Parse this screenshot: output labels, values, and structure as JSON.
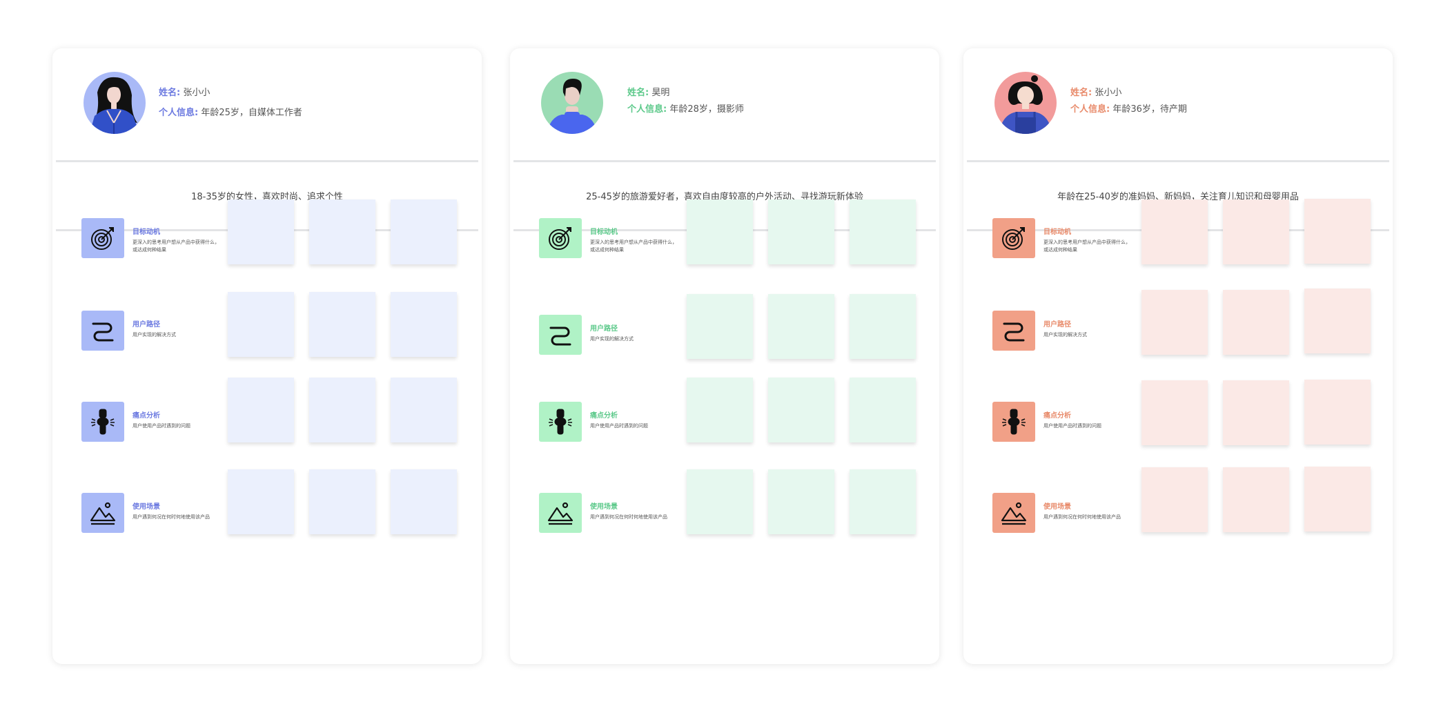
{
  "theme_colors": {
    "blue": {
      "accent": "#6b79e0",
      "avatar_bg": "#a9b9f7",
      "icon_bg": "#a9b9f7",
      "note": "#ebf0fd"
    },
    "green": {
      "accent": "#5cc98a",
      "avatar_bg": "#9adcb4",
      "icon_bg": "#b0f2c6",
      "note": "#e6f8ef"
    },
    "red": {
      "accent": "#e88a6a",
      "avatar_bg": "#f29b9b",
      "icon_bg": "#f1a087",
      "note": "#fbe9e6"
    }
  },
  "personas": [
    {
      "theme": "blue",
      "name_label": "姓名:",
      "name": "张小小",
      "info_label": "个人信息:",
      "info": "年龄25岁，自媒体工作者",
      "description": "18-35岁的女性，喜欢时尚、追求个性",
      "avatar_icon": "woman-long-hair-avatar-icon",
      "sections": [
        {
          "icon": "target-icon",
          "title": "目标动机",
          "desc": "更深入的思考用户想从产品中获得什么，或达成何种结果"
        },
        {
          "icon": "path-icon",
          "title": "用户路径",
          "desc": "用户实现的解决方式"
        },
        {
          "icon": "joint-pain-icon",
          "title": "痛点分析",
          "desc": "用户使用产品时遇到的问题"
        },
        {
          "icon": "landscape-icon",
          "title": "使用场景",
          "desc": "用户遇到何况在何时何地使用该产品"
        }
      ]
    },
    {
      "theme": "green",
      "name_label": "姓名:",
      "name": "昊明",
      "info_label": "个人信息:",
      "info": "年龄28岁，摄影师",
      "description": "25-45岁的旅游爱好者，喜欢自由度较高的户外活动、寻找游玩新体验",
      "avatar_icon": "man-turtleneck-avatar-icon",
      "sections": [
        {
          "icon": "target-icon",
          "title": "目标动机",
          "desc": "更深入的思考用户想从产品中获得什么，或达成何种结果"
        },
        {
          "icon": "path-icon",
          "title": "用户路径",
          "desc": "用户实现的解决方式"
        },
        {
          "icon": "joint-pain-icon",
          "title": "痛点分析",
          "desc": "用户使用产品时遇到的问题"
        },
        {
          "icon": "landscape-icon",
          "title": "使用场景",
          "desc": "用户遇到何况在何时何地使用该产品"
        }
      ]
    },
    {
      "theme": "red",
      "name_label": "姓名:",
      "name": "张小小",
      "info_label": "个人信息:",
      "info": "年龄36岁，待产期",
      "description": "年龄在25-40岁的准妈妈、新妈妈，关注育儿知识和母婴用品",
      "avatar_icon": "woman-bun-overalls-avatar-icon",
      "sections": [
        {
          "icon": "target-icon",
          "title": "目标动机",
          "desc": "更深入的思考用户想从产品中获得什么，或达成何种结果"
        },
        {
          "icon": "path-icon",
          "title": "用户路径",
          "desc": "用户实现的解决方式"
        },
        {
          "icon": "joint-pain-icon",
          "title": "痛点分析",
          "desc": "用户使用产品时遇到的问题"
        },
        {
          "icon": "landscape-icon",
          "title": "使用场景",
          "desc": "用户遇到何况在何时何地使用该产品"
        }
      ]
    }
  ]
}
